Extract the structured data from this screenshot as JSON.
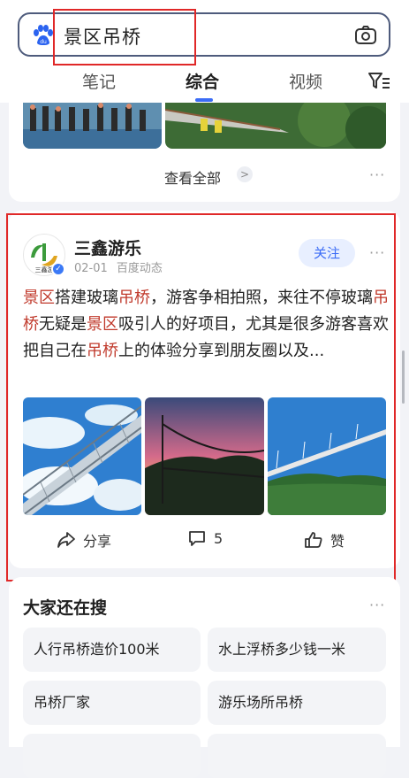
{
  "search": {
    "query": "景区吊桥"
  },
  "tabs": [
    {
      "label": "笔记"
    },
    {
      "label": "综合"
    },
    {
      "label": "视频"
    }
  ],
  "prev_card": {
    "view_all_label": "查看全部",
    "arrow": ">",
    "more": "···"
  },
  "post": {
    "author": "三鑫游乐",
    "avatar_text": "三鑫游",
    "date": "02-01",
    "source": "百度动态",
    "follow_label": "关注",
    "more": "···",
    "text_segments": [
      {
        "t": "景区",
        "hl": true
      },
      {
        "t": "搭建玻璃",
        "hl": false
      },
      {
        "t": "吊桥",
        "hl": true
      },
      {
        "t": "，游客争相拍照，来往不停玻璃",
        "hl": false
      },
      {
        "t": "吊桥",
        "hl": true
      },
      {
        "t": "无疑是",
        "hl": false
      },
      {
        "t": "景区",
        "hl": true
      },
      {
        "t": "吸引人的好项目，尤其是很多游客喜欢把自己在",
        "hl": false
      },
      {
        "t": "吊桥",
        "hl": true
      },
      {
        "t": "上的体验分享到朋友圈以及...",
        "hl": false
      }
    ],
    "actions": {
      "share_label": "分享",
      "comment_count": "5",
      "like_label": "赞"
    }
  },
  "related": {
    "title": "大家还在搜",
    "more": "···",
    "items": [
      "人行吊桥造价100米",
      "水上浮桥多少钱一米",
      "吊桥厂家",
      "游乐场所吊桥"
    ]
  },
  "colors": {
    "accent": "#3b6cf6",
    "highlight": "#c0392b",
    "annotation_box": "#e02828"
  },
  "icons": [
    "baidu-paw-icon",
    "camera-icon",
    "filter-icon",
    "share-icon",
    "comment-icon",
    "like-icon",
    "verified-icon"
  ]
}
